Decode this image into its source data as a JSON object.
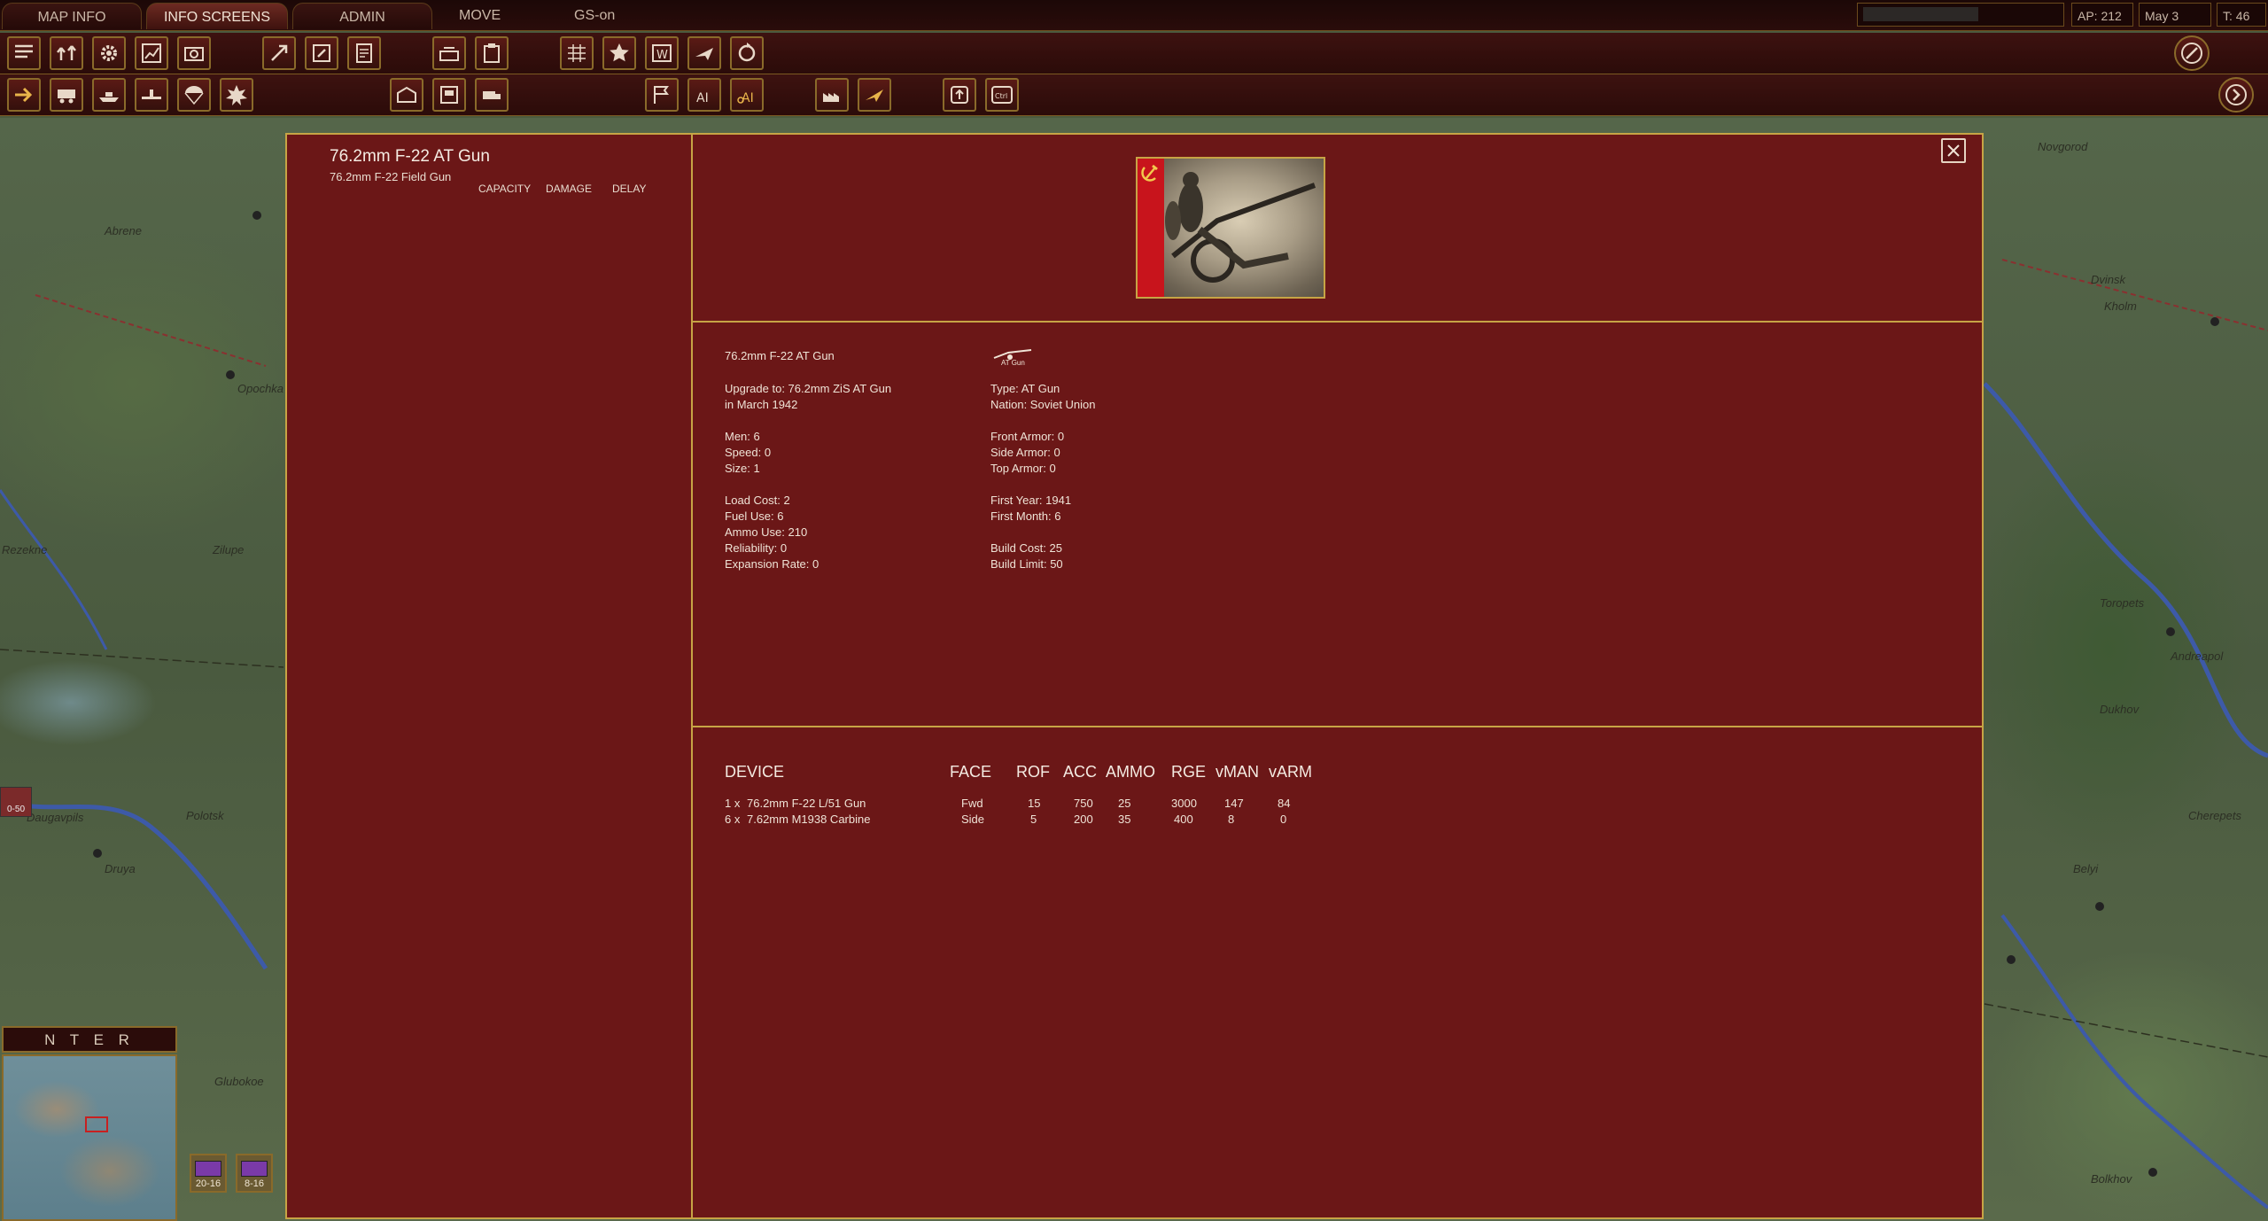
{
  "menu": {
    "tabs": [
      "MAP INFO",
      "INFO SCREENS",
      "ADMIN"
    ],
    "active_tab": "INFO SCREENS",
    "plain": [
      "MOVE",
      "GS-on"
    ],
    "status": {
      "ap": "AP: 212",
      "date": "May 3 1942",
      "turn": "T: 46"
    }
  },
  "unit": {
    "name": "76.2mm F-22 AT Gun",
    "subname": "76.2mm F-22 Field Gun",
    "columns": [
      "CAPACITY",
      "DAMAGE",
      "DELAY"
    ],
    "designation": "76.2mm F-22 AT Gun",
    "icon_label": "AT Gun",
    "upgrade_line": "Upgrade to:   76.2mm ZiS AT Gun",
    "upgrade_date": "in March 1942",
    "men": "Men:  6",
    "speed": "Speed:  0",
    "size": "Size:  1",
    "load_cost": "Load Cost:  2",
    "fuel_use": "Fuel Use:  6",
    "ammo_use": "Ammo Use:  210",
    "reliability": "Reliability:  0",
    "expansion_rate": "Expansion Rate:  0",
    "type": "Type: AT Gun",
    "nation": "Nation: Soviet Union",
    "front_armor": "Front Armor:  0",
    "side_armor": "Side Armor:  0",
    "top_armor": "Top Armor:   0",
    "first_year": "First Year:  1941",
    "first_month": "First Month: 6",
    "build_cost": "Build Cost:  25",
    "build_limit": "Build Limit:  50"
  },
  "devices": {
    "headers": [
      "DEVICE",
      "FACE",
      "ROF",
      "ACC",
      "AMMO",
      "RGE",
      "vMAN",
      "vARM"
    ],
    "rows": [
      {
        "qty": "1 x",
        "name": "76.2mm F-22 L/51 Gun",
        "face": "Fwd",
        "rof": "15",
        "acc": "750",
        "ammo": "25",
        "rge": "3000",
        "vman": "147",
        "varm": "84"
      },
      {
        "qty": "6 x",
        "name": "7.62mm M1938 Carbine",
        "face": "Side",
        "rof": "5",
        "acc": "200",
        "ammo": "35",
        "rge": "400",
        "vman": "8",
        "varm": "0"
      }
    ]
  },
  "minimap": {
    "title": "N T E R"
  },
  "map": {
    "towns_left": [
      "Abrene",
      "Opochka",
      "Rezekne",
      "Zilupe",
      "Daugavpils",
      "Druya",
      "Glubokoe",
      "Polotsk"
    ],
    "towns_right": [
      "Novgorod",
      "Dvinsk",
      "Kholm",
      "Toropets",
      "Andreapol",
      "Dukhov",
      "Cherepets",
      "Belyi",
      "Bolkhov"
    ],
    "counters": [
      {
        "label": "20-16"
      },
      {
        "label": "8-16"
      }
    ],
    "left_counter_label": "0-50"
  },
  "colors": {
    "panel": "#6b1717",
    "gold": "#c7a445",
    "toolbar": "#3d1210"
  },
  "icons": [
    "close-icon",
    "hammer-sickle-icon",
    "at-gun-icon"
  ]
}
